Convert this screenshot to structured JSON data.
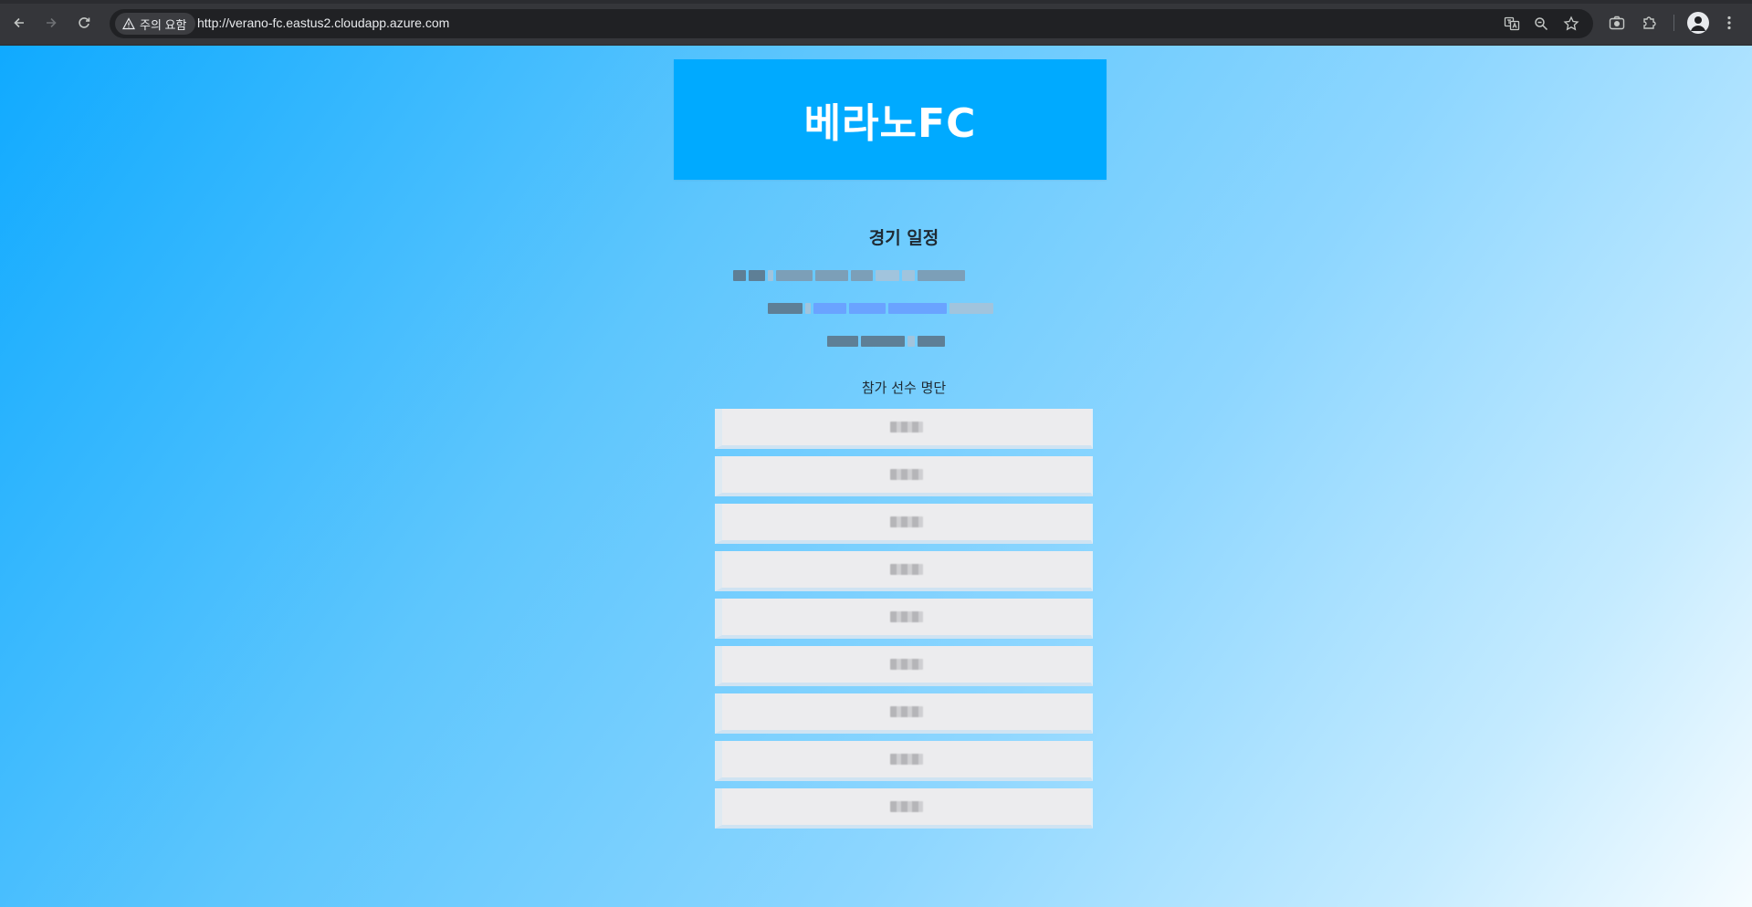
{
  "browser": {
    "security_chip_label": "주의 요함",
    "url": "http://verano-fc.eastus2.cloudapp.azure.com",
    "icons": {
      "back": "arrow-left-icon",
      "forward": "arrow-right-icon",
      "reload": "reload-icon",
      "warning": "warning-triangle-icon",
      "translate": "translate-icon",
      "zoom": "zoom-icon",
      "bookmark": "star-icon",
      "screenshot": "camera-icon",
      "extensions": "puzzle-icon",
      "profile": "profile-avatar-icon",
      "menu": "kebab-menu-icon"
    }
  },
  "page": {
    "header_title": "베라노FC",
    "section_title": "경기 일정",
    "roster_title": "참가 선수 명단",
    "players": [
      "",
      "",
      "",
      "",
      "",
      "",
      "",
      "",
      ""
    ],
    "colors": {
      "header_bg": "#00aaff",
      "header_text": "#ffffff",
      "card_bg": "#ececee",
      "gradient_start": "#10aaff",
      "gradient_end": "#f6fcff"
    }
  }
}
